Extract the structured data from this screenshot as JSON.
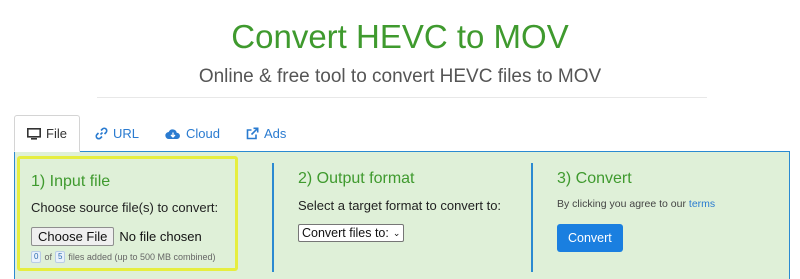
{
  "header": {
    "title": "Convert HEVC to MOV",
    "subtitle": "Online & free tool to convert HEVC files to MOV"
  },
  "tabs": [
    {
      "label": "File",
      "icon": "monitor-icon",
      "active": true
    },
    {
      "label": "URL",
      "icon": "link-icon",
      "active": false
    },
    {
      "label": "Cloud",
      "icon": "cloud-icon",
      "active": false
    },
    {
      "label": "Ads",
      "icon": "external-link-icon",
      "active": false
    }
  ],
  "step1": {
    "title": "1) Input file",
    "description": "Choose source file(s) to convert:",
    "choose_button": "Choose File",
    "no_file": "No file chosen",
    "count_current": "0",
    "of_text": "of",
    "count_max": "5",
    "files_added_text": "files added (up to 500 MB combined)"
  },
  "step2": {
    "title": "2) Output format",
    "description": "Select a target format to convert to:",
    "select_value": "Convert files to:"
  },
  "step3": {
    "title": "3) Convert",
    "agree_prefix": "By clicking you agree to our",
    "terms_link": "terms",
    "convert_button": "Convert"
  },
  "colors": {
    "title_green": "#3f9a2e",
    "panel_bg": "#dff0d8",
    "panel_border": "#2b8ad1",
    "highlight": "#e6ee3f",
    "button_blue": "#1a7fe0",
    "link_blue": "#2a7bd0"
  }
}
